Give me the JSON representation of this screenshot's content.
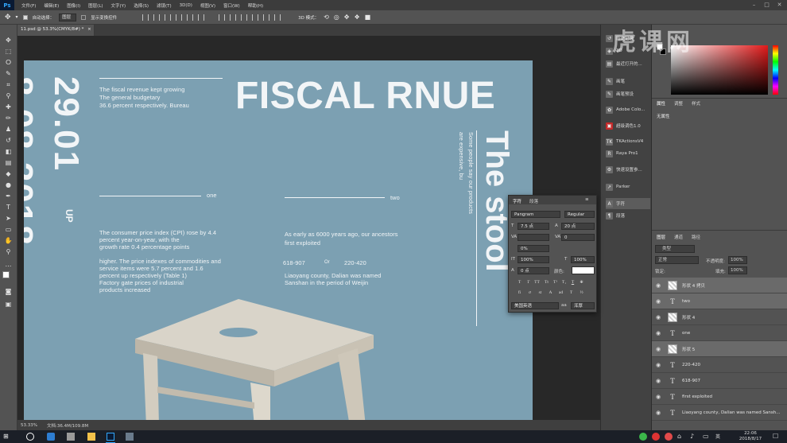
{
  "menubar": {
    "logo": "Ps",
    "items": [
      "文件(F)",
      "编辑(E)",
      "图像(I)",
      "图层(L)",
      "文字(Y)",
      "选择(S)",
      "滤镜(T)",
      "3D(D)",
      "视图(V)",
      "窗口(W)",
      "帮助(H)"
    ],
    "minimize": "–",
    "maximize": "□",
    "close": "✕"
  },
  "options": {
    "auto_select_label": "自动选择：",
    "auto_select_value": "图层",
    "show_transform_label": "显示变换控件",
    "mode_label": "3D 模式："
  },
  "document": {
    "tab_title": "11.psd @ 53.3%(CMYK/8#) *",
    "tab_close": "×"
  },
  "artwork": {
    "title": "FISCAL RNUE",
    "intro": [
      "The fiscal revenue kept growing",
      "The general budgetary",
      "36.6 percent respectively. Bureau"
    ],
    "date_big": "29.01",
    "up_label": "UP",
    "date_partial": "8.08.2018",
    "label_one": "one",
    "label_two": "two",
    "para1": [
      "The consumer price index (CPI) rose by 4.4",
      "percent year-on-year, with the",
      "growth rate 0.4 percentage points"
    ],
    "para2": [
      "higher. The price indexes of commodities and",
      "service items were 5.7 percent and 1.6",
      "percent up respectively (Table 1)",
      "Factory gate prices of industrial",
      "products increased"
    ],
    "para3": [
      "As early as 6000 years ago, our ancestors",
      "first exploited"
    ],
    "range1": "618-907",
    "or_label": "Or",
    "range2": "220-420",
    "para4": [
      "Liaoyang county, Dalian was named",
      "Sanshan in the period of Weijin"
    ],
    "vertical_title": "The stool",
    "vertical_sub": [
      "Some people say our products",
      "are expensive, bu"
    ]
  },
  "statusbar": {
    "zoom": "53.33%",
    "doc_info": "文档:36.4M/109.8M"
  },
  "midcol": {
    "items": [
      "历史记录",
      "3D",
      "最近打开的...",
      "画笔",
      "画笔预设",
      "Adobe Colo...",
      "超级调色1.0",
      "TKActionsV4",
      "Raya Pro1",
      "快速设置参...",
      "Parker",
      "字符",
      "段落"
    ]
  },
  "properties": {
    "tabs": [
      "属性",
      "调整",
      "样式"
    ],
    "empty": "无属性"
  },
  "layers": {
    "tabs": [
      "图层",
      "通道",
      "路径"
    ],
    "filter": "类型",
    "blend_mode": "正常",
    "opacity_label": "不透明度:",
    "opacity_value": "100%",
    "lock_label": "锁定:",
    "fill_label": "填充:",
    "fill_value": "100%",
    "rows": [
      {
        "type": "shape",
        "name": "形状 4 拷贝",
        "selected": true
      },
      {
        "type": "text",
        "name": "two",
        "selected": true
      },
      {
        "type": "shape",
        "name": "形状 4",
        "selected": false
      },
      {
        "type": "text",
        "name": "one",
        "selected": false
      },
      {
        "type": "shape",
        "name": "形状 5",
        "selected": true
      },
      {
        "type": "text",
        "name": "220-420",
        "selected": false
      },
      {
        "type": "text",
        "name": "618-907",
        "selected": false
      },
      {
        "type": "text",
        "name": "first exploited",
        "selected": false
      },
      {
        "type": "text",
        "name": "Liaoyang county, Dalian was named Sansh...",
        "selected": false
      }
    ]
  },
  "character_panel": {
    "tabs": [
      "字符",
      "段落"
    ],
    "font_family": "Pangram",
    "font_style": "Regular",
    "size": "7.5 点",
    "leading": "20 点",
    "kerning": "",
    "tracking": "0",
    "scale_label": "0%",
    "vscale": "100%",
    "hscale": "100%",
    "baseline": "0 点",
    "color_label": "颜色:",
    "language": "美国英语",
    "aa": "浑厚",
    "aa_label": "aa"
  },
  "taskbar": {
    "time": "22:06",
    "date": "2018/8/17",
    "ime": "英"
  },
  "watermark": "虎课网",
  "colors": {
    "artboard": "#7ca0b2",
    "panel": "#535353"
  }
}
